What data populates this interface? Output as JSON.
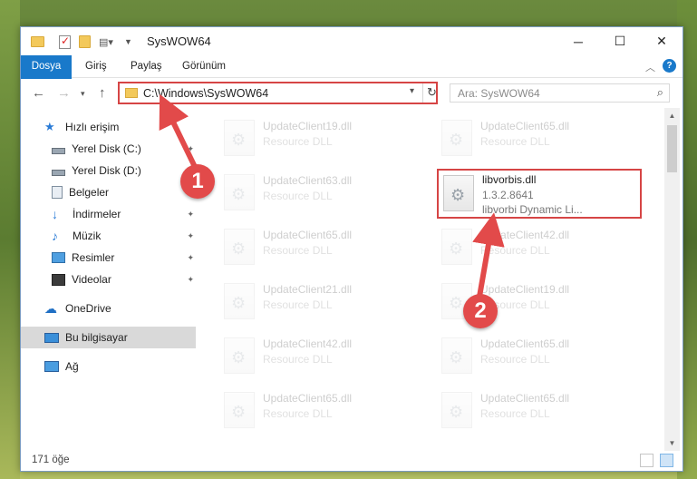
{
  "window": {
    "title": "SysWOW64"
  },
  "ribbon": {
    "tabs": [
      "Dosya",
      "Giriş",
      "Paylaş",
      "Görünüm"
    ]
  },
  "address": {
    "path": "C:\\Windows\\SysWOW64"
  },
  "search": {
    "placeholder": "Ara: SysWOW64"
  },
  "sidebar": {
    "items": [
      {
        "label": "Hızlı erişim",
        "icon": "star-icon",
        "pinned": false
      },
      {
        "label": "Yerel Disk (C:)",
        "icon": "drive-icon",
        "pinned": true
      },
      {
        "label": "Yerel Disk (D:)",
        "icon": "drive-icon",
        "pinned": true
      },
      {
        "label": "Belgeler",
        "icon": "documents-icon",
        "pinned": true
      },
      {
        "label": "İndirmeler",
        "icon": "download-icon",
        "pinned": true
      },
      {
        "label": "Müzik",
        "icon": "music-icon",
        "pinned": true
      },
      {
        "label": "Resimler",
        "icon": "pictures-icon",
        "pinned": true
      },
      {
        "label": "Videolar",
        "icon": "videos-icon",
        "pinned": true
      },
      {
        "label": "OneDrive",
        "icon": "cloud-icon",
        "pinned": false
      },
      {
        "label": "Bu bilgisayar",
        "icon": "computer-icon",
        "pinned": false,
        "selected": true
      },
      {
        "label": "Ağ",
        "icon": "network-icon",
        "pinned": false
      }
    ]
  },
  "files": [
    {
      "name": "UpdateClient19.dll",
      "desc": "Resource DLL",
      "faded": true
    },
    {
      "name": "UpdateClient65.dll",
      "desc": "Resource DLL",
      "faded": true
    },
    {
      "name": "UpdateClient63.dll",
      "desc": "Resource DLL",
      "faded": true
    },
    {
      "name": "libvorbis.dll",
      "version": "1.3.2.8641",
      "desc": "libvorbi Dynamic Li...",
      "faded": false,
      "highlighted": true
    },
    {
      "name": "UpdateClient65.dll",
      "desc": "Resource DLL",
      "faded": true
    },
    {
      "name": "UpdateClient42.dll",
      "desc": "Resource DLL",
      "faded": true
    },
    {
      "name": "UpdateClient21.dll",
      "desc": "Resource DLL",
      "faded": true
    },
    {
      "name": "UpdateClient19.dll",
      "desc": "Resource DLL",
      "faded": true
    },
    {
      "name": "UpdateClient42.dll",
      "desc": "Resource DLL",
      "faded": true
    },
    {
      "name": "UpdateClient65.dll",
      "desc": "Resource DLL",
      "faded": true
    },
    {
      "name": "UpdateClient65.dll",
      "desc": "Resource DLL",
      "faded": true
    },
    {
      "name": "UpdateClient65.dll",
      "desc": "Resource DLL",
      "faded": true
    }
  ],
  "status": {
    "count": "171 öğe"
  },
  "annotations": {
    "step1": "1",
    "step2": "2",
    "color": "#e24a4a"
  }
}
